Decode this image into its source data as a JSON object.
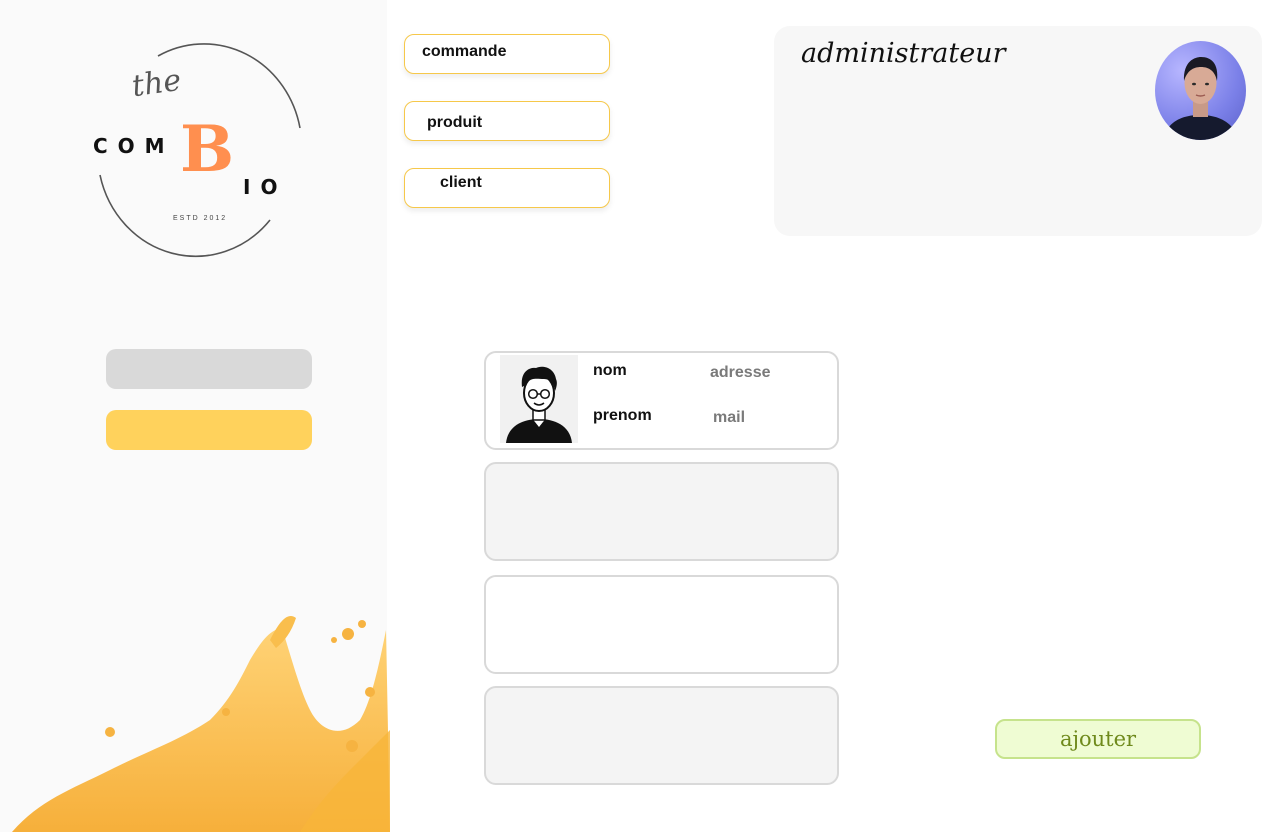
{
  "logo": {
    "the": "the",
    "com": "COM",
    "b": "B",
    "io": "IO",
    "estd": "ESTD 2012",
    "accent_color": "#ff8f4f"
  },
  "nav": {
    "commande": "commande",
    "produit": "produit",
    "client": "client",
    "border_color": "#f6c84a"
  },
  "admin": {
    "title": "administrateur"
  },
  "client_card": {
    "nom_label": "nom",
    "prenom_label": "prenom",
    "adresse": "adresse",
    "mail": "mail"
  },
  "actions": {
    "ajouter_label": "ajouter"
  },
  "colors": {
    "sidebar_bg": "#fafafa",
    "yellow_button": "#ffd25c",
    "grey_button": "#d9d9d9",
    "add_button_bg": "#effcd3",
    "add_button_text": "#6f8a1c"
  }
}
